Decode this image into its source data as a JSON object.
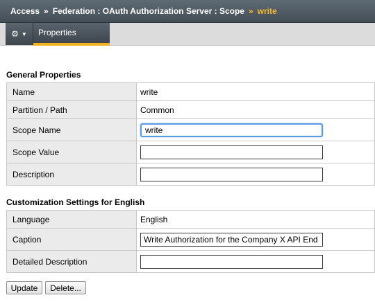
{
  "breadcrumb": {
    "items": [
      "Access",
      "Federation : OAuth Authorization Server : Scope"
    ],
    "separator": "»",
    "current": "write"
  },
  "tabbar": {
    "gear_icon": "⚙",
    "caret_icon": "▼",
    "active_tab": "Properties"
  },
  "general": {
    "title": "General Properties",
    "name_label": "Name",
    "name_value": "write",
    "partition_label": "Partition / Path",
    "partition_value": "Common",
    "scope_name_label": "Scope Name",
    "scope_name_value": "write",
    "scope_value_label": "Scope Value",
    "scope_value_value": "",
    "description_label": "Description",
    "description_value": ""
  },
  "customization": {
    "title": "Customization Settings for English",
    "language_label": "Language",
    "language_value": "English",
    "caption_label": "Caption",
    "caption_value": "Write Authorization for the Company X API End",
    "detailed_label": "Detailed Description",
    "detailed_value": ""
  },
  "actions": {
    "update": "Update",
    "delete": "Delete..."
  },
  "colors": {
    "breadcrumb_current": "#f3b72b",
    "tab_underline": "#f0b323",
    "focus_border": "#5b9be6"
  }
}
